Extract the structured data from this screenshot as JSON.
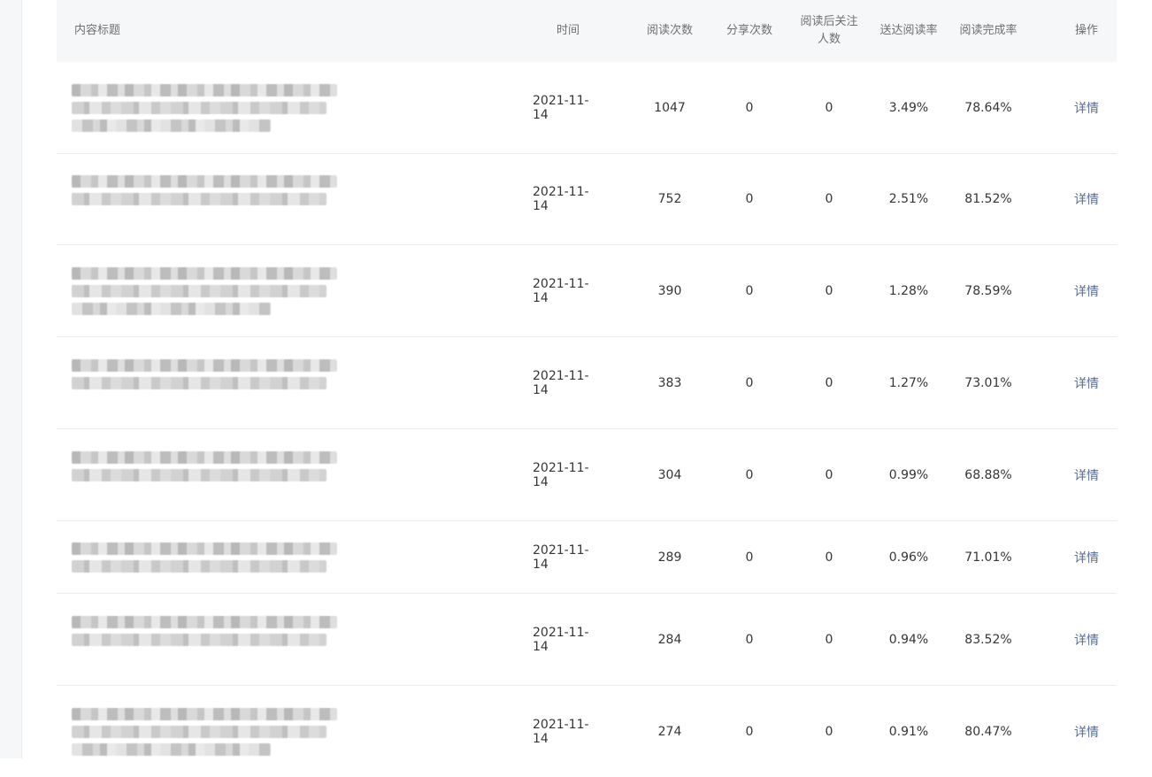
{
  "table": {
    "headers": {
      "title": "内容标题",
      "time": "时间",
      "reads": "阅读次数",
      "shares": "分享次数",
      "follow_line1": "阅读后关注",
      "follow_line2": "人数",
      "delivery_rate": "送达阅读率",
      "completion_rate": "阅读完成率",
      "action": "操作"
    },
    "rows": [
      {
        "time": "2021-11-14",
        "reads": "1047",
        "shares": "0",
        "follow": "0",
        "delivery_rate": "3.49%",
        "completion_rate": "78.64%",
        "action": "详情"
      },
      {
        "time": "2021-11-14",
        "reads": "752",
        "shares": "0",
        "follow": "0",
        "delivery_rate": "2.51%",
        "completion_rate": "81.52%",
        "action": "详情"
      },
      {
        "time": "2021-11-14",
        "reads": "390",
        "shares": "0",
        "follow": "0",
        "delivery_rate": "1.28%",
        "completion_rate": "78.59%",
        "action": "详情"
      },
      {
        "time": "2021-11-14",
        "reads": "383",
        "shares": "0",
        "follow": "0",
        "delivery_rate": "1.27%",
        "completion_rate": "73.01%",
        "action": "详情"
      },
      {
        "time": "2021-11-14",
        "reads": "304",
        "shares": "0",
        "follow": "0",
        "delivery_rate": "0.99%",
        "completion_rate": "68.88%",
        "action": "详情"
      },
      {
        "time": "2021-11-14",
        "reads": "289",
        "shares": "0",
        "follow": "0",
        "delivery_rate": "0.96%",
        "completion_rate": "71.01%",
        "action": "详情"
      },
      {
        "time": "2021-11-14",
        "reads": "284",
        "shares": "0",
        "follow": "0",
        "delivery_rate": "0.94%",
        "completion_rate": "83.52%",
        "action": "详情"
      },
      {
        "time": "2021-11-14",
        "reads": "274",
        "shares": "0",
        "follow": "0",
        "delivery_rate": "0.91%",
        "completion_rate": "80.47%",
        "action": "详情"
      }
    ]
  }
}
